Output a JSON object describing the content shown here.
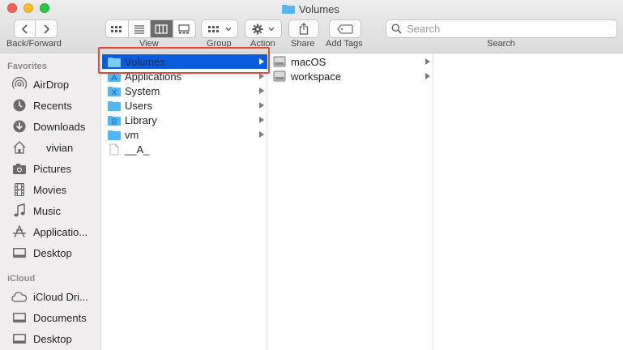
{
  "window": {
    "title": "Volumes"
  },
  "toolbar": {
    "back_forward_label": "Back/Forward",
    "view_label": "View",
    "group_label": "Group",
    "action_label": "Action",
    "share_label": "Share",
    "add_tags_label": "Add Tags",
    "search_label": "Search",
    "search_placeholder": "Search",
    "active_view": "columns"
  },
  "sidebar": {
    "favorites_header": "Favorites",
    "favorites": [
      {
        "label": "AirDrop",
        "icon": "airdrop-icon"
      },
      {
        "label": "Recents",
        "icon": "clock-icon"
      },
      {
        "label": "Downloads",
        "icon": "download-icon"
      },
      {
        "label": "vivian",
        "icon": "home-icon"
      },
      {
        "label": "Pictures",
        "icon": "camera-icon"
      },
      {
        "label": "Movies",
        "icon": "film-icon"
      },
      {
        "label": "Music",
        "icon": "music-note-icon"
      },
      {
        "label": "Applicatio...",
        "icon": "applications-icon"
      },
      {
        "label": "Desktop",
        "icon": "desktop-icon"
      }
    ],
    "icloud_header": "iCloud",
    "icloud": [
      {
        "label": "iCloud Dri...",
        "icon": "cloud-icon"
      },
      {
        "label": "Documents",
        "icon": "document-icon"
      },
      {
        "label": "Desktop",
        "icon": "desktop-icon"
      }
    ]
  },
  "column1": {
    "items": [
      {
        "name": "Volumes",
        "icon": "folder-icon",
        "selected": true,
        "has_children": true
      },
      {
        "name": "Applications",
        "icon": "applications-folder-icon",
        "has_children": true
      },
      {
        "name": "System",
        "icon": "system-folder-icon",
        "has_children": true
      },
      {
        "name": "Users",
        "icon": "users-folder-icon",
        "has_children": true
      },
      {
        "name": "Library",
        "icon": "library-folder-icon",
        "has_children": true
      },
      {
        "name": "vm",
        "icon": "folder-icon",
        "has_children": true
      },
      {
        "name": "__A_",
        "icon": "file-icon",
        "has_children": false
      }
    ]
  },
  "column2": {
    "items": [
      {
        "name": "macOS",
        "icon": "hard-drive-icon",
        "has_children": true
      },
      {
        "name": "workspace",
        "icon": "hard-drive-icon",
        "has_children": true
      }
    ]
  },
  "colors": {
    "selection": "#0b5cdd",
    "folder": "#54b6f0",
    "highlight_box": "#e04a3a"
  }
}
